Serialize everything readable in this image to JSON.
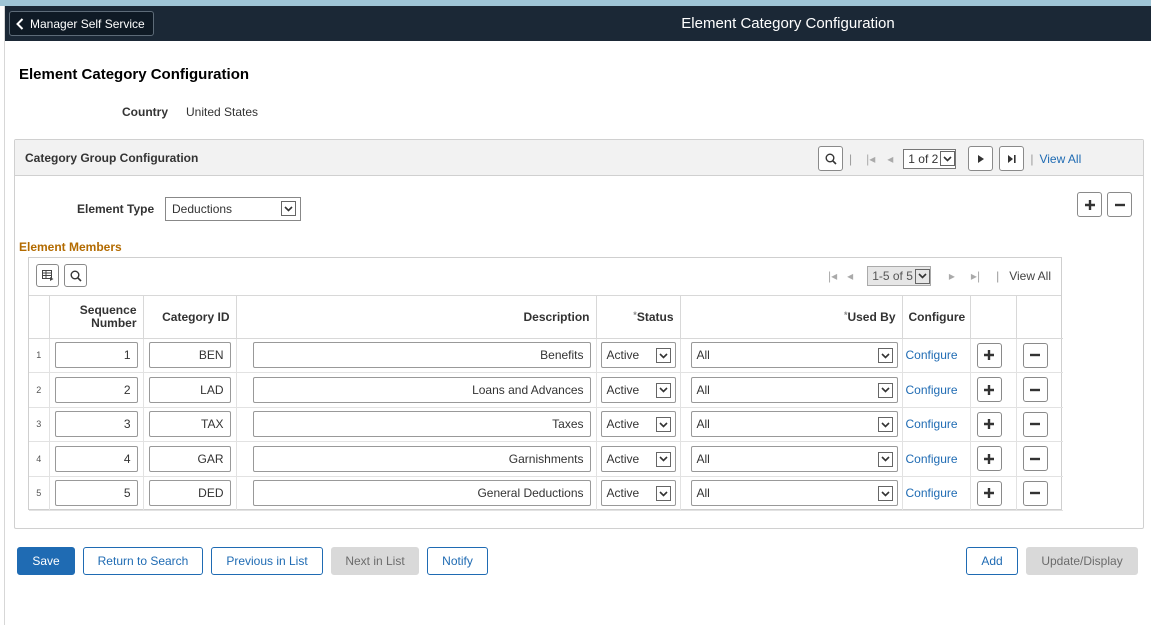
{
  "banner": {
    "back_label": "Manager Self Service",
    "title": "Element Category Configuration"
  },
  "page": {
    "title": "Element Category Configuration",
    "country_label": "Country",
    "country_value": "United States"
  },
  "group": {
    "title": "Category Group Configuration",
    "pager": {
      "current": "1 of 2",
      "view_all": "View All"
    },
    "element_type_label": "Element Type",
    "element_type_value": "Deductions",
    "members_title": "Element Members"
  },
  "members_grid": {
    "pager": {
      "range": "1-5 of 5",
      "view_all": "View All"
    },
    "columns": [
      "Sequence Number",
      "Category ID",
      "Description",
      "Status",
      "Used By",
      "Configure"
    ],
    "required_mark": "*",
    "rows": [
      {
        "n": "1",
        "seq": "1",
        "cat": "BEN",
        "desc": "Benefits",
        "status": "Active",
        "used_by": "All",
        "configure": "Configure"
      },
      {
        "n": "2",
        "seq": "2",
        "cat": "LAD",
        "desc": "Loans and Advances",
        "status": "Active",
        "used_by": "All",
        "configure": "Configure"
      },
      {
        "n": "3",
        "seq": "3",
        "cat": "TAX",
        "desc": "Taxes",
        "status": "Active",
        "used_by": "All",
        "configure": "Configure"
      },
      {
        "n": "4",
        "seq": "4",
        "cat": "GAR",
        "desc": "Garnishments",
        "status": "Active",
        "used_by": "All",
        "configure": "Configure"
      },
      {
        "n": "5",
        "seq": "5",
        "cat": "DED",
        "desc": "General Deductions",
        "status": "Active",
        "used_by": "All",
        "configure": "Configure"
      }
    ]
  },
  "buttons": {
    "save": "Save",
    "return": "Return to Search",
    "previous": "Previous in List",
    "next": "Next in List",
    "notify": "Notify",
    "add": "Add",
    "update": "Update/Display"
  },
  "colors": {
    "banner": "#1b2836",
    "link": "#1f6bb3",
    "section_title": "#b36b00"
  }
}
